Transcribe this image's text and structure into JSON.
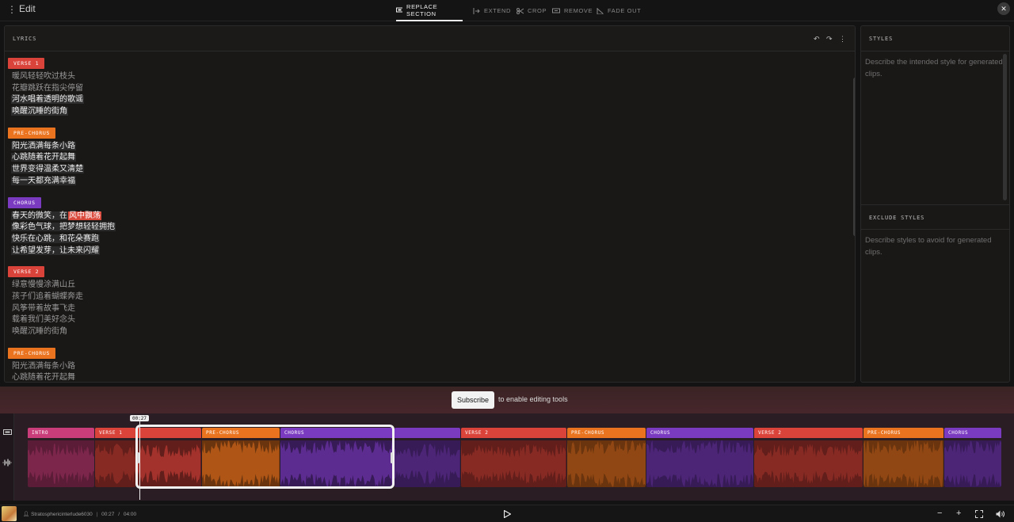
{
  "topbar": {
    "menu_icon": "vertical-dots-icon",
    "title": "Edit",
    "tabs": [
      {
        "label": "REPLACE SECTION",
        "icon": "replace-section-icon",
        "active": true
      },
      {
        "label": "EXTEND",
        "icon": "extend-icon",
        "active": false
      },
      {
        "label": "CROP",
        "icon": "scissors-icon",
        "active": false
      },
      {
        "label": "REMOVE",
        "icon": "remove-icon",
        "active": false
      },
      {
        "label": "FADE OUT",
        "icon": "fade-out-icon",
        "active": false
      }
    ],
    "close": "✕"
  },
  "lyrics": {
    "header": "LYRICS",
    "sections": [
      {
        "tag": "VERSE 1",
        "color": "#d9433a",
        "lines": [
          "暖风轻轻吹过枝头",
          "花瓣跳跃在指尖停留",
          "河水唱着透明的歌谣",
          "唤醒沉睡的街角"
        ]
      },
      {
        "tag": "PRE-CHORUS",
        "color": "#e9731f",
        "lines": [
          "阳光洒满每条小路",
          "心跳随着花开起舞",
          "世界变得温柔又清楚",
          "每一天都充满幸福"
        ]
      },
      {
        "tag": "CHORUS",
        "color": "#7a3bc0",
        "lines": [
          "春天的微笑，在风中飘荡",
          "像彩色气球，把梦想轻轻拥抱",
          "快乐在心跳，和花朵赛跑",
          "让希望发芽，让未来闪耀"
        ]
      },
      {
        "tag": "VERSE 2",
        "color": "#d9433a",
        "lines": [
          "绿意慢慢涂满山丘",
          "孩子们追着蝴蝶奔走",
          "风筝带着故事飞走",
          "载着我们美好念头",
          "唤醒沉睡的街角"
        ]
      },
      {
        "tag": "PRE-CHORUS",
        "color": "#e9731f",
        "lines": [
          "阳光洒满每条小路",
          "心跳随着花开起舞"
        ]
      }
    ],
    "chorus_line1_prefix": "春天的微笑，在",
    "chorus_line1_highlight": "风中飘荡"
  },
  "styles": {
    "header": "STYLES",
    "placeholder": "Describe the intended style for generated clips.",
    "exclude_header": "EXCLUDE STYLES",
    "exclude_placeholder": "Describe styles to avoid for generated clips."
  },
  "subscribe": {
    "button": "Subscribe",
    "note": "to enable editing tools"
  },
  "timeline": {
    "playhead_time": "00:27",
    "segments": [
      {
        "label": "INTRO",
        "color": "#c93e7a"
      },
      {
        "label": "VERSE 1",
        "color": "#d9433a"
      },
      {
        "label": "",
        "color": "#d9433a"
      },
      {
        "label": "PRE-CHORUS",
        "color": "#e9731f"
      },
      {
        "label": "CHORUS",
        "color": "#7a3bc0"
      },
      {
        "label": "",
        "color": "#7a3bc0"
      },
      {
        "label": "VERSE 2",
        "color": "#d9433a"
      },
      {
        "label": "PRE-CHORUS",
        "color": "#e9731f"
      },
      {
        "label": "CHORUS",
        "color": "#7a3bc0"
      },
      {
        "label": "VERSE 2",
        "color": "#d9433a"
      },
      {
        "label": "PRE-CHORUS",
        "color": "#e9731f"
      },
      {
        "label": "CHORUS",
        "color": "#7a3bc0"
      }
    ]
  },
  "player": {
    "username": "Stratosphericinterlude6030",
    "current_time": "00:27",
    "separator": "/",
    "duration": "04:00"
  }
}
